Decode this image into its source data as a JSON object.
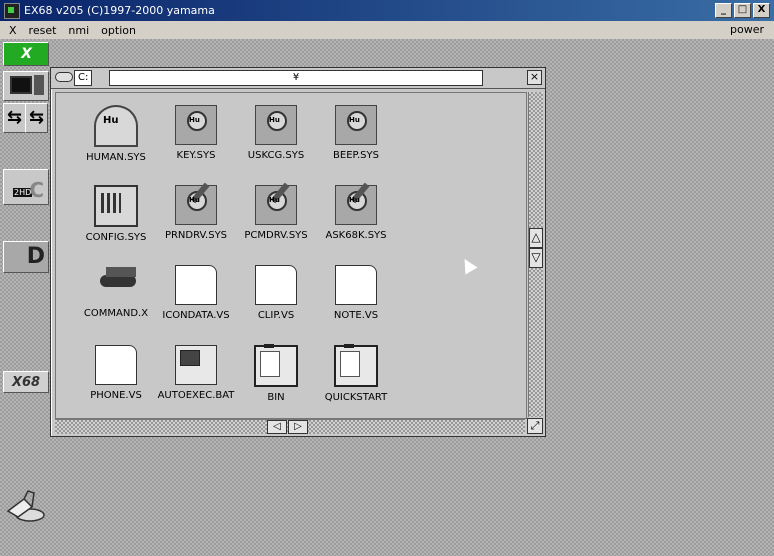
{
  "window": {
    "title": "EX68 v205 (C)1997-2000 yamama",
    "minimize": "_",
    "maximize": "□",
    "close": "X"
  },
  "menu": {
    "items": [
      "X",
      "reset",
      "nmi",
      "option"
    ],
    "power": "power"
  },
  "sidebar": {
    "logo_top": "X",
    "drive_label": "2HD",
    "drive_d": "D",
    "logo_bottom": "X68",
    "arrow_left": "⇆",
    "arrow_right": "⇆"
  },
  "file_window": {
    "drive": "C:",
    "path": "¥",
    "close": "×",
    "scroll_up": "△",
    "scroll_down": "▽",
    "scroll_left": "◁",
    "scroll_right": "▷",
    "resize": "⤢",
    "files": [
      {
        "name": "HUMAN.SYS",
        "icon": "human"
      },
      {
        "name": "KEY.SYS",
        "icon": "plate"
      },
      {
        "name": "USKCG.SYS",
        "icon": "plate"
      },
      {
        "name": "BEEP.SYS",
        "icon": "plate"
      },
      {
        "name": "CONFIG.SYS",
        "icon": "config"
      },
      {
        "name": "PRNDRV.SYS",
        "icon": "plate-pen"
      },
      {
        "name": "PCMDRV.SYS",
        "icon": "plate-pen"
      },
      {
        "name": "ASK68K.SYS",
        "icon": "plate-pen"
      },
      {
        "name": "COMMAND.X",
        "icon": "tank"
      },
      {
        "name": "ICONDATA.VS",
        "icon": "doc"
      },
      {
        "name": "CLIP.VS",
        "icon": "doc"
      },
      {
        "name": "NOTE.VS",
        "icon": "doc"
      },
      {
        "name": "PHONE.VS",
        "icon": "doc"
      },
      {
        "name": "AUTOEXEC.BAT",
        "icon": "bat"
      },
      {
        "name": "BIN",
        "icon": "folder"
      },
      {
        "name": "QUICKSTART",
        "icon": "folder"
      }
    ]
  }
}
